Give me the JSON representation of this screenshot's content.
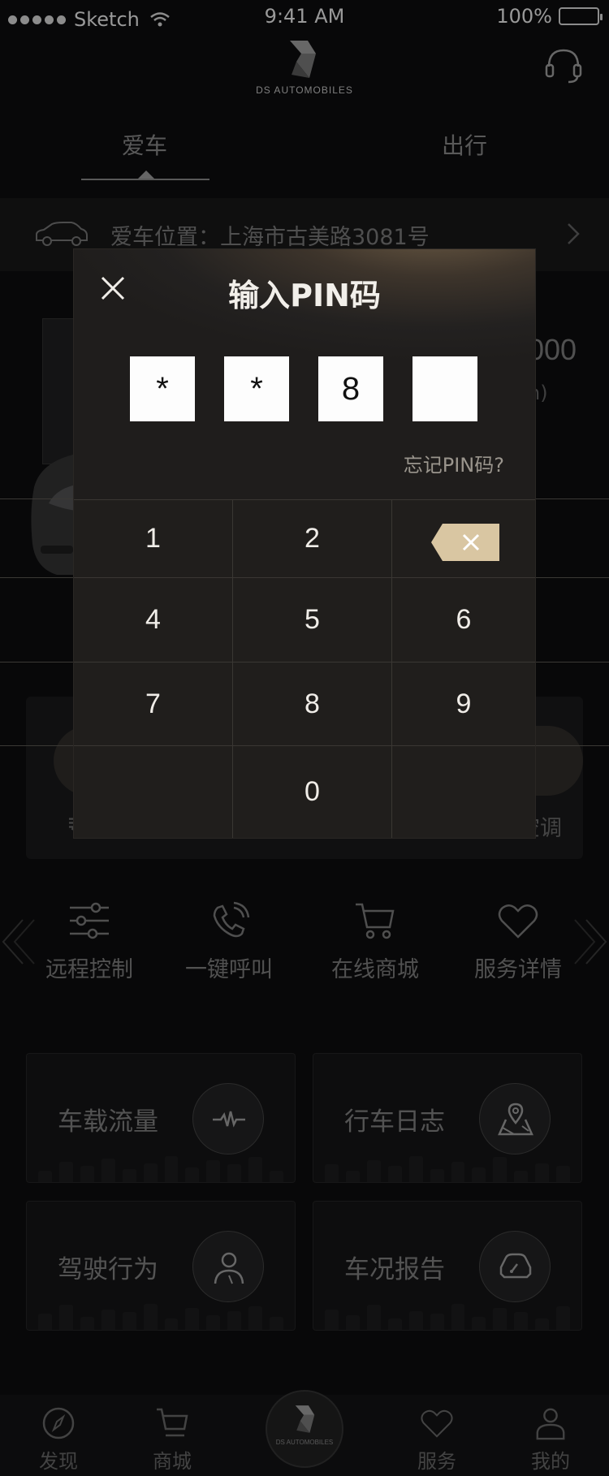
{
  "status_bar": {
    "carrier": "Sketch",
    "time": "9:41 AM",
    "battery": "100%"
  },
  "header": {
    "brand": "DS AUTOMOBILES"
  },
  "tabs": [
    {
      "label": "爱车",
      "active": true
    },
    {
      "label": "出行",
      "active": false
    }
  ],
  "location": {
    "text": "爱车位置：上海市古美路3081号"
  },
  "car_info": {
    "mileage_partial": "000",
    "unit_partial": "n)"
  },
  "controls": {
    "left_label_partial": "≢",
    "right_label_partial": "空调"
  },
  "functions": [
    {
      "label": "远程控制",
      "icon": "sliders-icon"
    },
    {
      "label": "一键呼叫",
      "icon": "phone-icon"
    },
    {
      "label": "在线商城",
      "icon": "cart-icon"
    },
    {
      "label": "服务详情",
      "icon": "heart-icon"
    }
  ],
  "feature_cards": [
    {
      "label": "车载流量",
      "icon": "pulse-icon"
    },
    {
      "label": "行车日志",
      "icon": "map-pin-icon"
    },
    {
      "label": "驾驶行为",
      "icon": "user-icon"
    },
    {
      "label": "车况报告",
      "icon": "car-gauge-icon"
    }
  ],
  "bottom_nav": [
    {
      "label": "发现",
      "icon": "compass-icon"
    },
    {
      "label": "商城",
      "icon": "cart-icon"
    },
    {
      "label": "",
      "icon": "ds-logo-icon",
      "center_text": "DS AUTOMOBILES"
    },
    {
      "label": "服务",
      "icon": "heart-icon"
    },
    {
      "label": "我的",
      "icon": "user-icon"
    }
  ],
  "pin_modal": {
    "title": "输入PIN码",
    "digits": [
      "*",
      "*",
      "8",
      ""
    ],
    "forgot_link": "忘记PIN码?",
    "keys": [
      "1",
      "2",
      "3",
      "4",
      "5",
      "6",
      "7",
      "8",
      "9",
      "",
      "0",
      "delete"
    ]
  },
  "colors": {
    "accent": "#d9c6a2",
    "modal_bg": "#201e1c",
    "page_bg": "#0b0b0c"
  }
}
